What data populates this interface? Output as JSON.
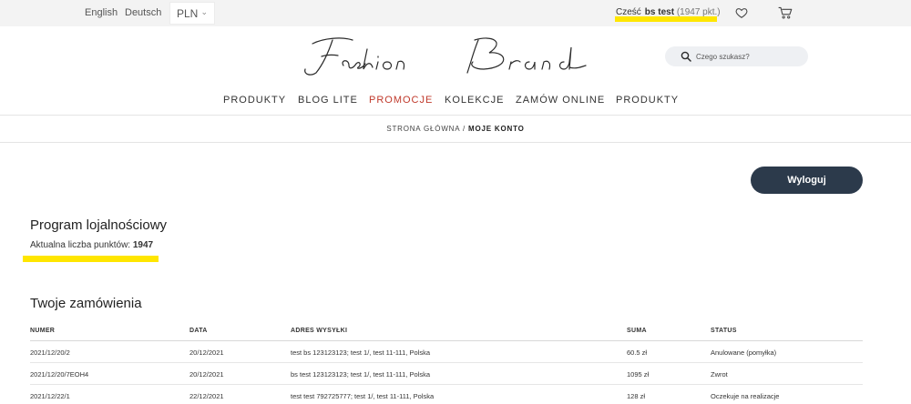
{
  "topbar": {
    "languages": [
      "English",
      "Deutsch"
    ],
    "currency": "PLN",
    "greeting": "Cześć",
    "username": "bs test",
    "points_text": "(1947 pkt.)"
  },
  "search": {
    "placeholder": "Czego szukasz?"
  },
  "logo": {
    "text": "Fashion Brand"
  },
  "nav": {
    "items": [
      "PRODUKTY",
      "BLOG LITE",
      "PROMOCJE",
      "KOLEKCJE",
      "ZAMÓW ONLINE",
      "PRODUKTY"
    ],
    "active_color": "#c0392b"
  },
  "breadcrumb": {
    "home": "STRONA GŁÓWNA /",
    "current": "MOJE KONTO"
  },
  "logout": {
    "label": "Wyloguj"
  },
  "loyalty": {
    "title": "Program lojalnościowy",
    "points_label": "Aktualna liczba punktów:",
    "points_value": "1947"
  },
  "orders": {
    "title": "Twoje zamówienia",
    "columns": [
      "NUMER",
      "DATA",
      "ADRES WYSYŁKI",
      "SUMA",
      "STATUS"
    ],
    "rows": [
      [
        "2021/12/20/2",
        "20/12/2021",
        "test bs 123123123; test 1/, test 11-111, Polska",
        "60.5 zł",
        "Anulowane (pomyłka)"
      ],
      [
        "2021/12/20/7EOH4",
        "20/12/2021",
        "bs test 123123123; test 1/, test 11-111, Polska",
        "1095 zł",
        "Zwrot"
      ],
      [
        "2021/12/22/1",
        "22/12/2021",
        "test test 792725777; test 1/, test 11-111, Polska",
        "128 zł",
        "Oczekuje na realizacje"
      ]
    ]
  },
  "colors": {
    "accent_dark": "#2c3a4b",
    "highlight": "#ffe600",
    "promo": "#c0392b"
  }
}
